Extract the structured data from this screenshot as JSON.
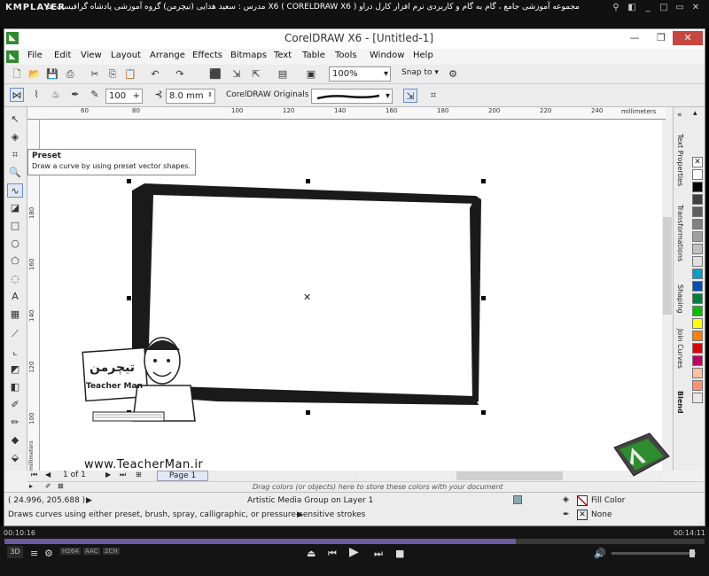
{
  "player": {
    "name": "KMPLAYER",
    "title": "مجموعه آموزشی جامع ، گام به گام و کاربردی نرم افزار کارل دراو X6 ( CORELDRAW X6 )  مدرس : سعید هدایی (تیچرمن) گروه آموزشی پادشاه گرافیست ها",
    "time_elapsed": "00:10:16",
    "time_total": "00:14:11",
    "progress": 0.73,
    "badges": [
      "H264",
      "AAC",
      "2CH"
    ]
  },
  "app": {
    "title": "CorelDRAW X6 - [Untitled-1]"
  },
  "menus": [
    "File",
    "Edit",
    "View",
    "Layout",
    "Arrange",
    "Effects",
    "Bitmaps",
    "Text",
    "Table",
    "Tools",
    "Window",
    "Help"
  ],
  "toolbar": {
    "zoom": "100%",
    "snap_label": "Snap to"
  },
  "property_bar": {
    "smoothing": "100",
    "width": "8.0 mm",
    "preset_label": "CorelDRAW Originals"
  },
  "ruler": {
    "h_ticks": [
      "60",
      "80",
      "100",
      "120",
      "140",
      "160",
      "180",
      "200",
      "220",
      "240"
    ],
    "v_ticks": [
      "200",
      "180",
      "160",
      "140",
      "120",
      "100"
    ],
    "unit": "millimeters",
    "unit_v": "millimeters"
  },
  "tooltip": {
    "title": "Preset",
    "desc": "Draw a curve by using preset vector shapes."
  },
  "dockers": [
    "Text Properties",
    "Transformations",
    "Shaping",
    "Join Curves",
    "Blend"
  ],
  "pages": {
    "count": "1 of 1",
    "tab": "Page 1"
  },
  "colorbar_hint": "Drag colors (or objects) here to store these colors with your document",
  "status": {
    "coords": "( 24.996, 205.688 )",
    "object": "Artistic Media Group on Layer 1",
    "fill_label": "Fill Color",
    "outline_label": "None",
    "hint": "Draws curves using either preset, brush, spray, calligraphic, or pressure-sensitive strokes"
  },
  "watermark": {
    "url": "www.TeacherMan.ir",
    "brand": "Teacher Man",
    "brand_fa": "تیچرمن"
  },
  "palette": [
    "#ffffff",
    "#000000",
    "#404040",
    "#606060",
    "#808080",
    "#a0a0a0",
    "#c0c0c0",
    "#e0e0e0",
    "#00a0c8",
    "#0050b4",
    "#008040",
    "#00c000",
    "#ffff00",
    "#ff8000",
    "#e00000",
    "#c00060",
    "#ffc0a0",
    "#ff9070",
    "#e8e8e8"
  ]
}
